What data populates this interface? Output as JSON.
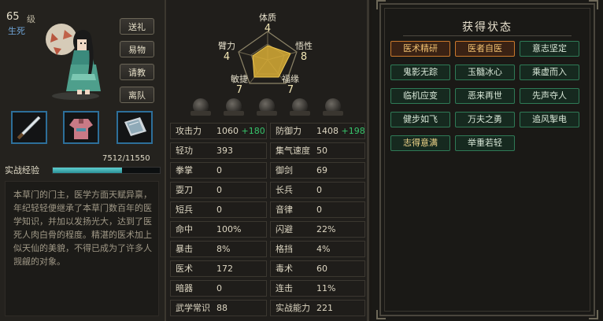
{
  "header": {
    "level": "65",
    "level_unit": "级",
    "status": "生死"
  },
  "side_buttons": [
    "送礼",
    "易物",
    "请教",
    "离队"
  ],
  "equipment": [
    {
      "name": "sword-icon"
    },
    {
      "name": "robe-icon"
    },
    {
      "name": "manual-icon"
    }
  ],
  "experience": {
    "label": "实战经验",
    "value": "7512/11550",
    "fill": 0.65
  },
  "description": "本草门的门主，医学方面天赋异禀，年纪轻轻便继承了本草门数百年的医学知识，并加以发扬光大，达到了医死人肉白骨的程度。精湛的医术加上似天仙的美貌，不得已成为了许多人觊觎的对象。",
  "attributes": [
    {
      "name": "体质",
      "value": "4"
    },
    {
      "name": "悟性",
      "value": "8"
    },
    {
      "name": "福缘",
      "value": "7"
    },
    {
      "name": "敏捷",
      "value": "7"
    },
    {
      "name": "臂力",
      "value": "4"
    }
  ],
  "stats": [
    [
      {
        "label": "攻击力",
        "value": "1060",
        "bonus": "+180"
      },
      {
        "label": "防御力",
        "value": "1408",
        "bonus": "+198"
      }
    ],
    [
      {
        "label": "轻功",
        "value": "393"
      },
      {
        "label": "集气速度",
        "value": "50"
      }
    ],
    [
      {
        "label": "拳掌",
        "value": "0"
      },
      {
        "label": "御剑",
        "value": "69"
      }
    ],
    [
      {
        "label": "耍刀",
        "value": "0"
      },
      {
        "label": "长兵",
        "value": "0"
      }
    ],
    [
      {
        "label": "短兵",
        "value": "0"
      },
      {
        "label": "音律",
        "value": "0"
      }
    ],
    [
      {
        "label": "命中",
        "value": "100%"
      },
      {
        "label": "闪避",
        "value": "22%"
      }
    ],
    [
      {
        "label": "暴击",
        "value": "8%"
      },
      {
        "label": "格挡",
        "value": "4%"
      }
    ],
    [
      {
        "label": "医术",
        "value": "172"
      },
      {
        "label": "毒术",
        "value": "60"
      }
    ],
    [
      {
        "label": "暗器",
        "value": "0"
      },
      {
        "label": "连击",
        "value": "11%"
      }
    ],
    [
      {
        "label": "武学常识",
        "value": "88"
      },
      {
        "label": "实战能力",
        "value": "221"
      }
    ]
  ],
  "status_panel": {
    "title": "获得状态",
    "badges": [
      {
        "label": "医术精研",
        "style": "orange"
      },
      {
        "label": "医者自医",
        "style": "orange"
      },
      {
        "label": "意志坚定",
        "style": "green"
      },
      {
        "label": "鬼影无踪",
        "style": "green"
      },
      {
        "label": "玉髓冰心",
        "style": "green"
      },
      {
        "label": "乘虚而入",
        "style": "green"
      },
      {
        "label": "临机应变",
        "style": "green"
      },
      {
        "label": "恶来再世",
        "style": "green"
      },
      {
        "label": "先声夺人",
        "style": "green"
      },
      {
        "label": "健步如飞",
        "style": "green"
      },
      {
        "label": "万夫之勇",
        "style": "green"
      },
      {
        "label": "追风掣电",
        "style": "green"
      },
      {
        "label": "志得意满",
        "style": "gold"
      },
      {
        "label": "举重若轻",
        "style": "green"
      }
    ]
  }
}
